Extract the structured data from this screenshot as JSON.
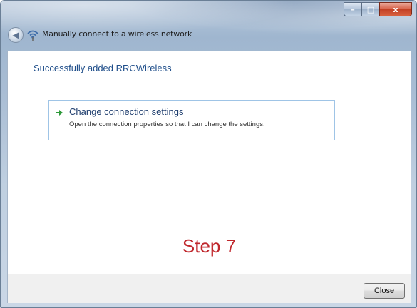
{
  "window": {
    "title": "Manually connect to a wireless network"
  },
  "caption_buttons": {
    "minimize": "–",
    "maximize": "□",
    "close": "x"
  },
  "content": {
    "heading": "Successfully added RRCWireless",
    "link": {
      "title_before": "C",
      "title_accel": "h",
      "title_after": "ange connection settings",
      "description": "Open the connection properties so that I can change the settings."
    },
    "step_label": "Step 7"
  },
  "footer": {
    "close_label": "Close"
  },
  "colors": {
    "heading": "#1f4e8a",
    "step_label": "#c0282d",
    "link_border": "#9fc4e6",
    "arrow": "#2e9a3a"
  }
}
